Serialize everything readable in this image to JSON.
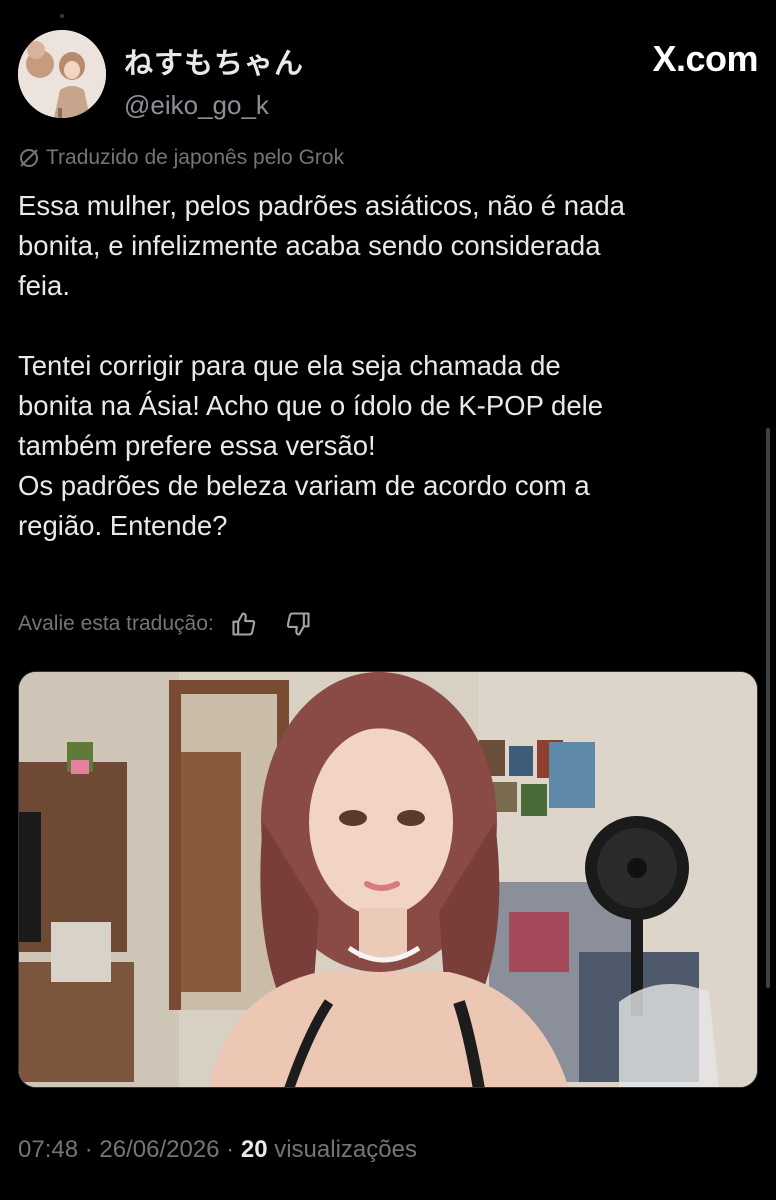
{
  "header": {
    "display_name": "ねすもちゃん",
    "handle": "@eiko_go_k",
    "brand": "X.com"
  },
  "translation_note": "Traduzido de japonês pelo Grok",
  "tweet": {
    "paragraph_1": [
      "Essa mulher, pelos padrões asiáticos, não é nada",
      "bonita, e infelizmente acaba sendo considerada",
      "feia."
    ],
    "paragraph_2": [
      "Tentei corrigir para que ela seja chamada de",
      "bonita na Ásia! Acho que o ídolo de K-POP dele",
      "também prefere essa versão!",
      "Os padrões de beleza variam de acordo com a",
      "região. Entende?"
    ]
  },
  "rate_translation": {
    "label": "Avalie esta tradução:",
    "thumbs_up_icon": "thumbs-up-icon",
    "thumbs_down_icon": "thumbs-down-icon"
  },
  "footer": {
    "time": "07:48",
    "separator_1": " · ",
    "date": "26/06/2026",
    "separator_2": " · ",
    "views_count": "20",
    "views_label": " visualizações"
  },
  "colors": {
    "background": "#000000",
    "text_primary": "#e7e9ea",
    "text_secondary": "#71767b"
  }
}
